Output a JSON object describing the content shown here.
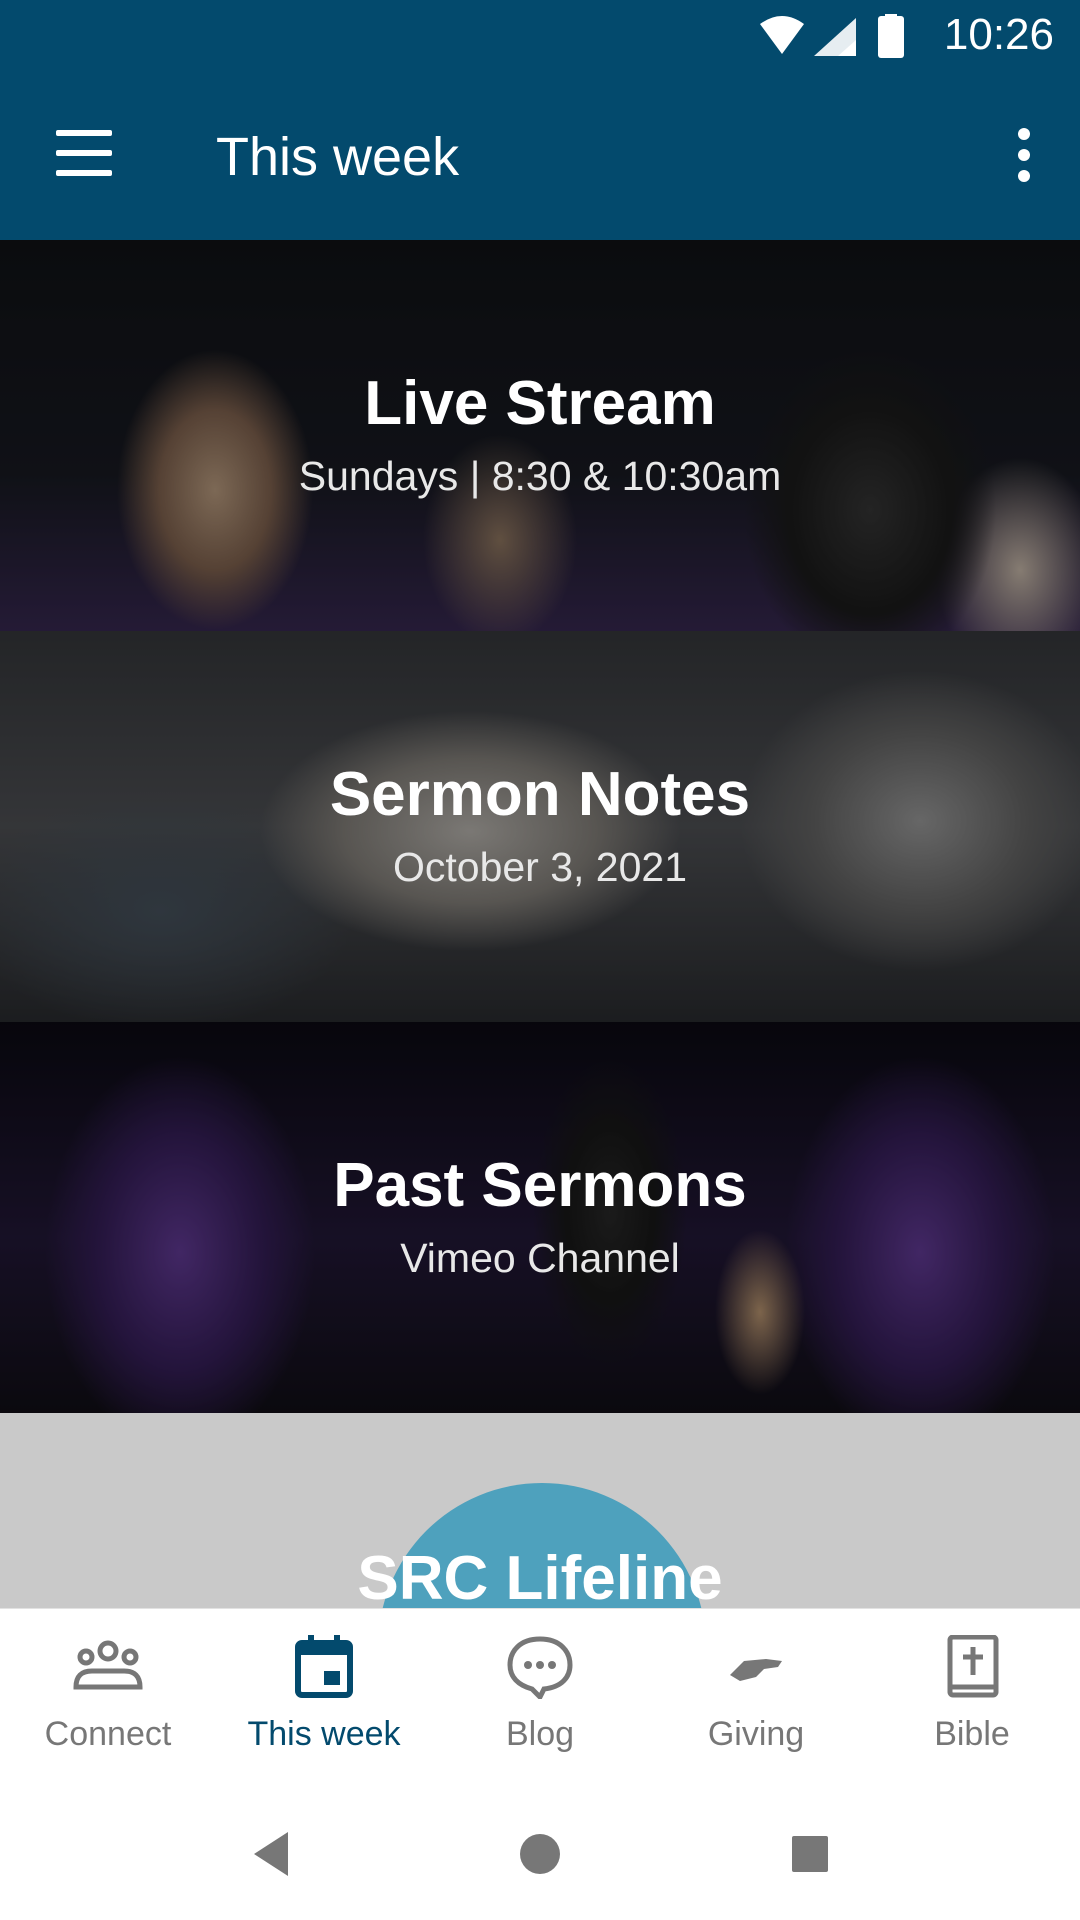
{
  "status_bar": {
    "time": "10:26",
    "icons": [
      "wifi-icon",
      "signal-icon",
      "battery-icon"
    ]
  },
  "app_bar": {
    "title": "This week",
    "menu_icon": "hamburger-menu-icon",
    "more_icon": "more-vert-icon"
  },
  "cards": [
    {
      "title": "Live Stream",
      "subtitle": "Sundays | 8:30 & 10:30am"
    },
    {
      "title": "Sermon Notes",
      "subtitle": "October 3, 2021"
    },
    {
      "title": "Past Sermons",
      "subtitle": "Vimeo Channel"
    }
  ],
  "lifeline": {
    "title": "SRC Lifeline"
  },
  "bottom_nav": {
    "items": [
      {
        "label": "Connect",
        "icon": "people-icon"
      },
      {
        "label": "This week",
        "icon": "calendar-icon"
      },
      {
        "label": "Blog",
        "icon": "chat-bubble-icon"
      },
      {
        "label": "Giving",
        "icon": "handshake-icon"
      },
      {
        "label": "Bible",
        "icon": "bible-icon"
      }
    ],
    "active": "This week"
  },
  "colors": {
    "primary": "#034a6d",
    "inactive": "#777777",
    "lifeline_bg": "#c9c9c9",
    "lifeline_circle": "#4ea1bd"
  }
}
